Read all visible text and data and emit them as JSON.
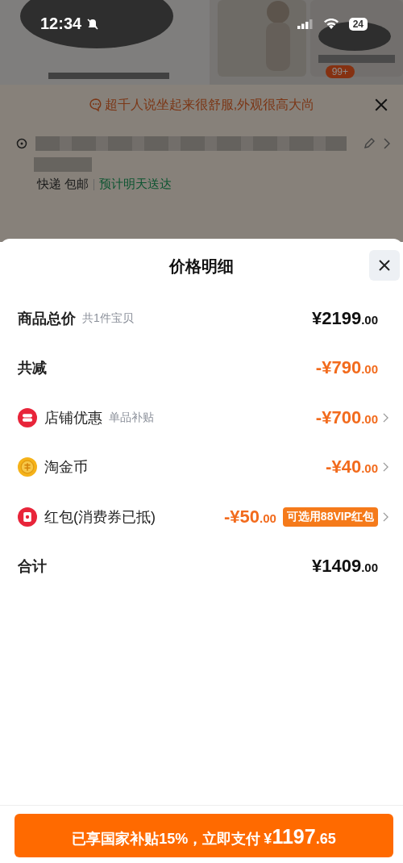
{
  "status_bar": {
    "time": "12:34",
    "battery": "24"
  },
  "gallery": {
    "badge": "99+"
  },
  "review_banner": {
    "text": "超千人说坐起来很舒服,外观很高大尚"
  },
  "shipping": {
    "method": "快递 包邮",
    "eta": "预计明天送达"
  },
  "sheet": {
    "title": "价格明细",
    "rows": [
      {
        "kind": "total",
        "label": "商品总价",
        "note": "共1件宝贝",
        "amount": "¥2199",
        "cents": ".00"
      },
      {
        "kind": "reduction",
        "label": "共减",
        "amount": "-¥790",
        "cents": ".00"
      },
      {
        "kind": "shop",
        "label": "店铺优惠",
        "note": "单品补贴",
        "amount": "-¥700",
        "cents": ".00"
      },
      {
        "kind": "coin",
        "label": "淘金币",
        "amount": "-¥40",
        "cents": ".00"
      },
      {
        "kind": "packet",
        "label": "红包(消费券已抵)",
        "amount": "-¥50",
        "cents": ".00",
        "tag": "可选用88VIP红包"
      },
      {
        "kind": "total",
        "label": "合计",
        "amount": "¥1409",
        "cents": ".00"
      }
    ],
    "pay_button": {
      "text": "已享国家补贴15%，立即支付",
      "currency": "¥",
      "amount": "1197",
      "cents": ".65"
    }
  }
}
